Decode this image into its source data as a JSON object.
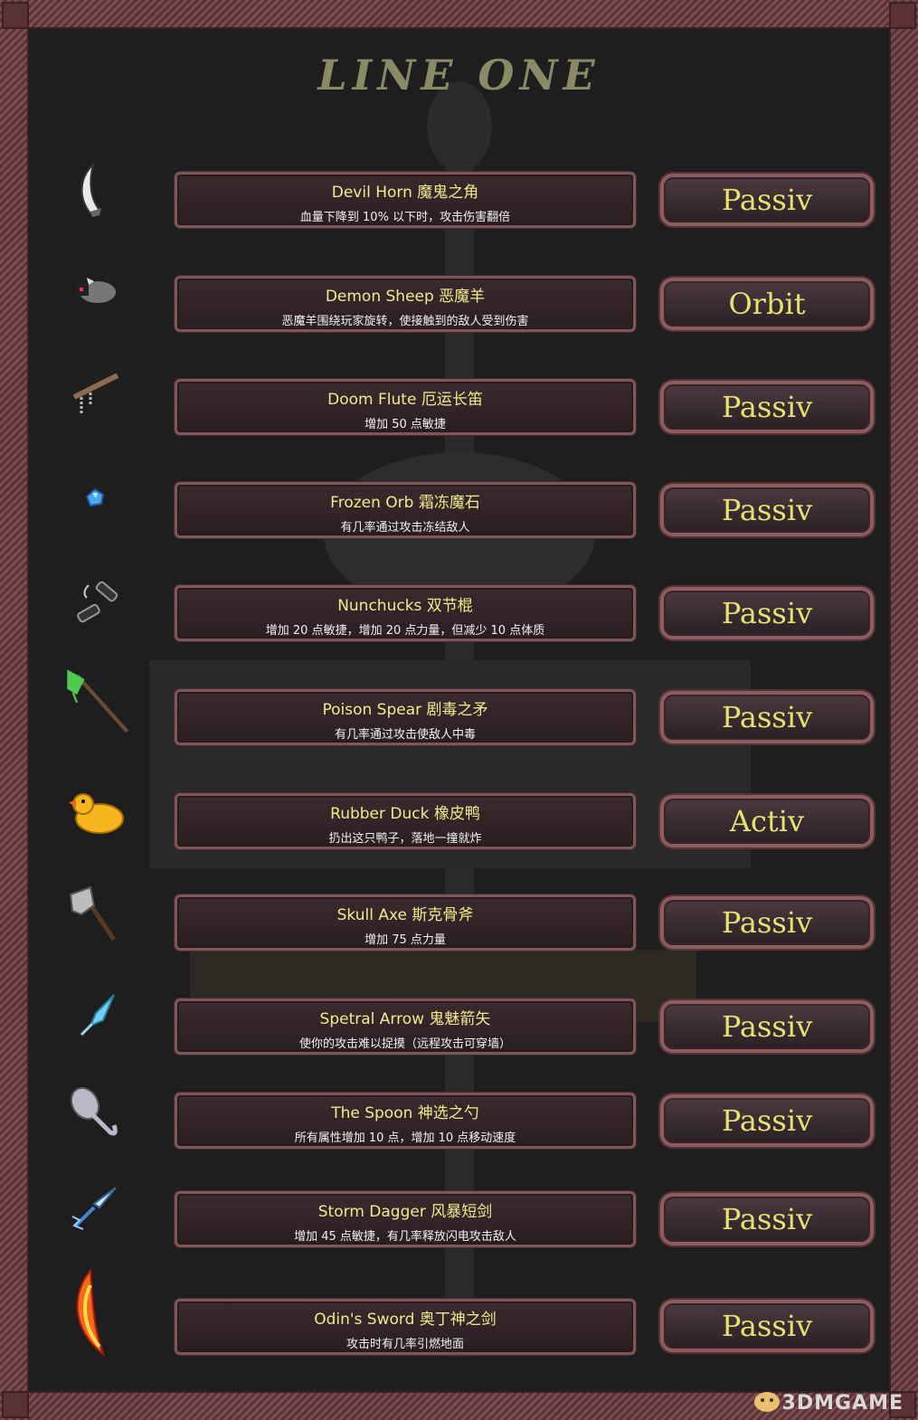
{
  "title": "LINE ONE",
  "items": [
    {
      "name": "Devil Horn 魔鬼之角",
      "effect": "血量下降到 10% 以下时，攻击伤害翻倍",
      "type": "Passiv",
      "icon": "horn-icon"
    },
    {
      "name": "Demon Sheep 恶魔羊",
      "effect": "恶魔羊围绕玩家旋转，使接触到的敌人受到伤害",
      "type": "Orbit",
      "icon": "sheep-icon"
    },
    {
      "name": "Doom Flute 厄运长笛",
      "effect": "增加 50 点敏捷",
      "type": "Passiv",
      "icon": "flute-icon"
    },
    {
      "name": "Frozen Orb 霜冻魔石",
      "effect": "有几率通过攻击冻结敌人",
      "type": "Passiv",
      "icon": "orb-icon"
    },
    {
      "name": "Nunchucks 双节棍",
      "effect": "增加 20 点敏捷，增加 20 点力量，但减少 10 点体质",
      "type": "Passiv",
      "icon": "nunchucks-icon"
    },
    {
      "name": "Poison Spear 剧毒之矛",
      "effect": "有几率通过攻击使敌人中毒",
      "type": "Passiv",
      "icon": "spear-icon"
    },
    {
      "name": "Rubber Duck 橡皮鸭",
      "effect": "扔出这只鸭子，落地一撞就炸",
      "type": "Activ",
      "icon": "duck-icon"
    },
    {
      "name": "Skull Axe 斯克骨斧",
      "effect": "增加 75 点力量",
      "type": "Passiv",
      "icon": "axe-icon"
    },
    {
      "name": "Spetral Arrow 鬼魅箭矢",
      "effect": "使你的攻击难以捉摸（远程攻击可穿墙）",
      "type": "Passiv",
      "icon": "arrow-icon"
    },
    {
      "name": "The Spoon 神选之勺",
      "effect": "所有属性增加 10 点，增加 10 点移动速度",
      "type": "Passiv",
      "icon": "spoon-icon"
    },
    {
      "name": "Storm Dagger 风暴短剑",
      "effect": "增加 45 点敏捷，有几率释放闪电攻击敌人",
      "type": "Passiv",
      "icon": "dagger-icon"
    },
    {
      "name": "Odin's Sword 奥丁神之剑",
      "effect": "攻击时有几率引燃地面",
      "type": "Passiv",
      "icon": "sword-icon"
    }
  ],
  "watermark": "3DMGAME"
}
